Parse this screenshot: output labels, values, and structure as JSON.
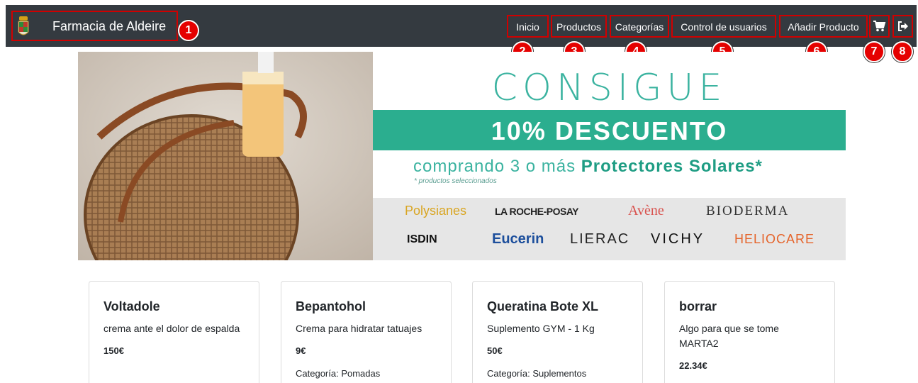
{
  "navbar": {
    "brand": "Farmacia de Aldeire",
    "links": [
      {
        "label": "Inicio",
        "badge": "2"
      },
      {
        "label": "Productos",
        "badge": "3"
      },
      {
        "label": "Categorías",
        "badge": "4"
      },
      {
        "label": "Control de usuarios",
        "badge": "5"
      },
      {
        "label": "Añadir Producto",
        "badge": "6"
      }
    ],
    "brand_badge": "1",
    "cart": {
      "icon": "cart-icon",
      "badge": "7"
    },
    "logout": {
      "icon": "logout-icon",
      "badge": "8"
    }
  },
  "banner": {
    "headline": "CONSIGUE",
    "discount": "10% DESCUENTO",
    "sub_prefix": "comprando 3 o más",
    "sub_bold": "Protectores Solares*",
    "note": "* productos seleccionados",
    "brands": [
      "Polysianes",
      "LA ROCHE-POSAY",
      "Avène",
      "BIODERMA",
      "ISDIN",
      "Eucerin",
      "LIERAC",
      "VICHY",
      "HELIOCARE"
    ]
  },
  "products": [
    {
      "name": "Voltadole",
      "description": "crema ante el dolor de espalda",
      "price": "150€",
      "category": ""
    },
    {
      "name": "Bepantohol",
      "description": "Crema para hidratar tatuajes",
      "price": "9€",
      "category": "Categoría: Pomadas"
    },
    {
      "name": "Queratina Bote XL",
      "description": "Suplemento GYM - 1 Kg",
      "price": "50€",
      "category": "Categoría: Suplementos"
    },
    {
      "name": "borrar",
      "description": "Algo para que se tome MARTA2",
      "price": "22.34€",
      "category": ""
    }
  ],
  "colors": {
    "navbar": "#343a40",
    "annotation": "#d00000",
    "teal": "#2bae8f"
  }
}
